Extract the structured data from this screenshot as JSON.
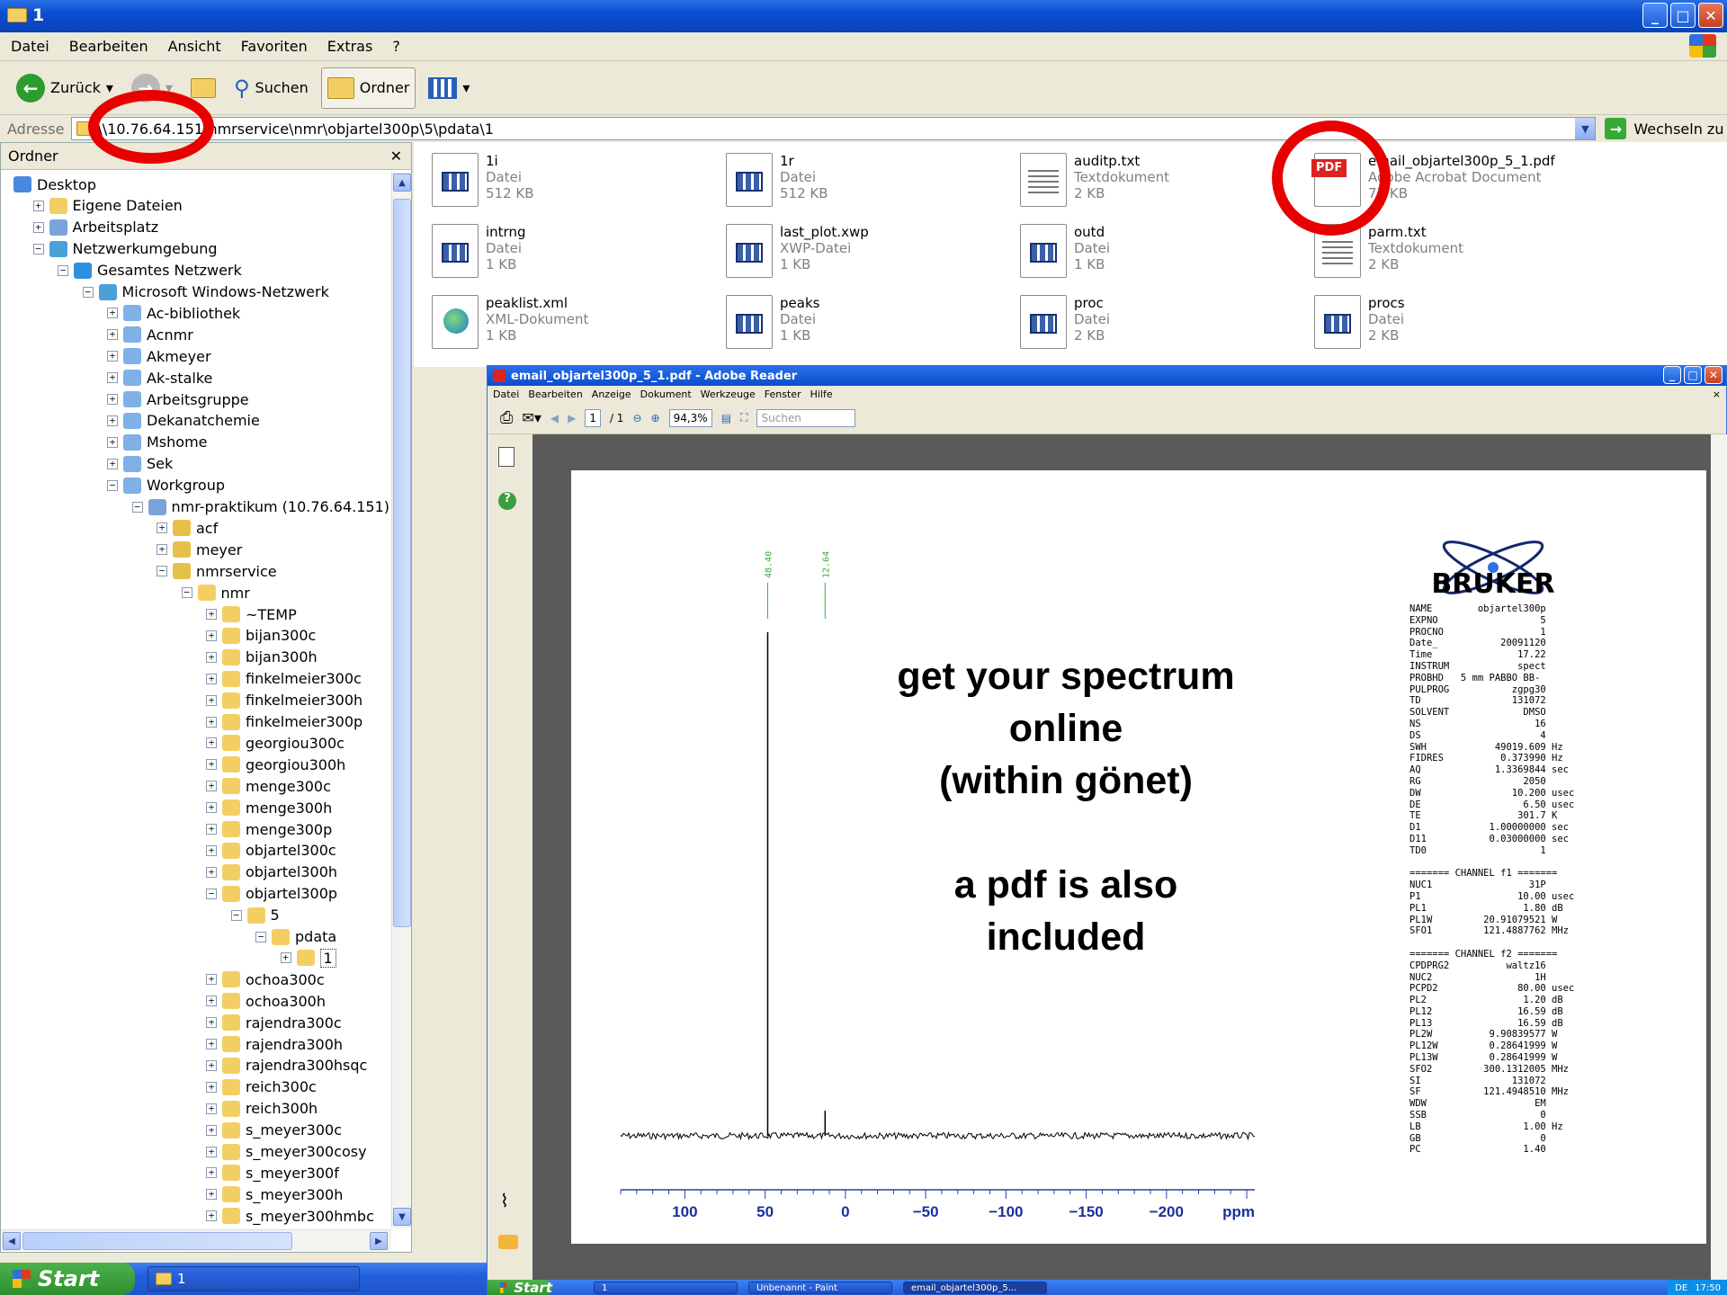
{
  "window": {
    "title": "1",
    "buttons": {
      "minimize": "_",
      "maximize": "□",
      "close": "✕"
    }
  },
  "menu": [
    "Datei",
    "Bearbeiten",
    "Ansicht",
    "Favoriten",
    "Extras",
    "?"
  ],
  "toolbar": {
    "back": "Zurück",
    "search": "Suchen",
    "folders": "Ordner"
  },
  "address": {
    "label": "Adresse",
    "value": "\\\\10.76.64.151\\nmrservice\\nmr\\objartel300p\\5\\pdata\\1",
    "go": "Wechseln zu"
  },
  "folder_pane": {
    "title": "Ordner",
    "close": "✕"
  },
  "tree": [
    {
      "label": "Desktop",
      "level": 0,
      "exp": "",
      "icon": "desktop-icon"
    },
    {
      "label": "Eigene Dateien",
      "level": 1,
      "exp": "+",
      "icon": "folder-icon"
    },
    {
      "label": "Arbeitsplatz",
      "level": 1,
      "exp": "+",
      "icon": "computer-icon"
    },
    {
      "label": "Netzwerkumgebung",
      "level": 1,
      "exp": "−",
      "icon": "network-icon"
    },
    {
      "label": "Gesamtes Netzwerk",
      "level": 2,
      "exp": "−",
      "icon": "globe-icon"
    },
    {
      "label": "Microsoft Windows-Netzwerk",
      "level": 3,
      "exp": "−",
      "icon": "network-icon"
    },
    {
      "label": "Ac-bibliothek",
      "level": 4,
      "exp": "+",
      "icon": "workgroup-icon"
    },
    {
      "label": "Acnmr",
      "level": 4,
      "exp": "+",
      "icon": "workgroup-icon"
    },
    {
      "label": "Akmeyer",
      "level": 4,
      "exp": "+",
      "icon": "workgroup-icon"
    },
    {
      "label": "Ak-stalke",
      "level": 4,
      "exp": "+",
      "icon": "workgroup-icon"
    },
    {
      "label": "Arbeitsgruppe",
      "level": 4,
      "exp": "+",
      "icon": "workgroup-icon"
    },
    {
      "label": "Dekanatchemie",
      "level": 4,
      "exp": "+",
      "icon": "workgroup-icon"
    },
    {
      "label": "Mshome",
      "level": 4,
      "exp": "+",
      "icon": "workgroup-icon"
    },
    {
      "label": "Sek",
      "level": 4,
      "exp": "+",
      "icon": "workgroup-icon"
    },
    {
      "label": "Workgroup",
      "level": 4,
      "exp": "−",
      "icon": "workgroup-icon"
    },
    {
      "label": "nmr-praktikum (10.76.64.151)",
      "level": 5,
      "exp": "−",
      "icon": "computer-icon"
    },
    {
      "label": "acf",
      "level": 6,
      "exp": "+",
      "icon": "share-icon"
    },
    {
      "label": "meyer",
      "level": 6,
      "exp": "+",
      "icon": "share-icon"
    },
    {
      "label": "nmrservice",
      "level": 6,
      "exp": "−",
      "icon": "share-icon"
    },
    {
      "label": "nmr",
      "level": 7,
      "exp": "−",
      "icon": "folder-icon"
    },
    {
      "label": "~TEMP",
      "level": 8,
      "exp": "+",
      "icon": "folder-icon"
    },
    {
      "label": "bijan300c",
      "level": 8,
      "exp": "+",
      "icon": "folder-icon"
    },
    {
      "label": "bijan300h",
      "level": 8,
      "exp": "+",
      "icon": "folder-icon"
    },
    {
      "label": "finkelmeier300c",
      "level": 8,
      "exp": "+",
      "icon": "folder-icon"
    },
    {
      "label": "finkelmeier300h",
      "level": 8,
      "exp": "+",
      "icon": "folder-icon"
    },
    {
      "label": "finkelmeier300p",
      "level": 8,
      "exp": "+",
      "icon": "folder-icon"
    },
    {
      "label": "georgiou300c",
      "level": 8,
      "exp": "+",
      "icon": "folder-icon"
    },
    {
      "label": "georgiou300h",
      "level": 8,
      "exp": "+",
      "icon": "folder-icon"
    },
    {
      "label": "menge300c",
      "level": 8,
      "exp": "+",
      "icon": "folder-icon"
    },
    {
      "label": "menge300h",
      "level": 8,
      "exp": "+",
      "icon": "folder-icon"
    },
    {
      "label": "menge300p",
      "level": 8,
      "exp": "+",
      "icon": "folder-icon"
    },
    {
      "label": "objartel300c",
      "level": 8,
      "exp": "+",
      "icon": "folder-icon"
    },
    {
      "label": "objartel300h",
      "level": 8,
      "exp": "+",
      "icon": "folder-icon"
    },
    {
      "label": "objartel300p",
      "level": 8,
      "exp": "−",
      "icon": "folder-icon"
    },
    {
      "label": "5",
      "level": 9,
      "exp": "−",
      "icon": "folder-icon"
    },
    {
      "label": "pdata",
      "level": 10,
      "exp": "−",
      "icon": "folder-icon"
    },
    {
      "label": "1",
      "level": 11,
      "exp": "+",
      "icon": "folder-icon",
      "selected": true
    },
    {
      "label": "ochoa300c",
      "level": 8,
      "exp": "+",
      "icon": "folder-icon"
    },
    {
      "label": "ochoa300h",
      "level": 8,
      "exp": "+",
      "icon": "folder-icon"
    },
    {
      "label": "rajendra300c",
      "level": 8,
      "exp": "+",
      "icon": "folder-icon"
    },
    {
      "label": "rajendra300h",
      "level": 8,
      "exp": "+",
      "icon": "folder-icon"
    },
    {
      "label": "rajendra300hsqc",
      "level": 8,
      "exp": "+",
      "icon": "folder-icon"
    },
    {
      "label": "reich300c",
      "level": 8,
      "exp": "+",
      "icon": "folder-icon"
    },
    {
      "label": "reich300h",
      "level": 8,
      "exp": "+",
      "icon": "folder-icon"
    },
    {
      "label": "s_meyer300c",
      "level": 8,
      "exp": "+",
      "icon": "folder-icon"
    },
    {
      "label": "s_meyer300cosy",
      "level": 8,
      "exp": "+",
      "icon": "folder-icon"
    },
    {
      "label": "s_meyer300f",
      "level": 8,
      "exp": "+",
      "icon": "folder-icon"
    },
    {
      "label": "s_meyer300h",
      "level": 8,
      "exp": "+",
      "icon": "folder-icon"
    },
    {
      "label": "s_meyer300hmbc",
      "level": 8,
      "exp": "+",
      "icon": "folder-icon"
    }
  ],
  "files": [
    {
      "name": "1i",
      "type": "Datei",
      "size": "512 KB",
      "kind": "data"
    },
    {
      "name": "1r",
      "type": "Datei",
      "size": "512 KB",
      "kind": "data"
    },
    {
      "name": "auditp.txt",
      "type": "Textdokument",
      "size": "2 KB",
      "kind": "text"
    },
    {
      "name": "email_objartel300p_5_1.pdf",
      "type": "Adobe Acrobat Document",
      "size": "77 KB",
      "kind": "pdf"
    },
    {
      "name": "intrng",
      "type": "Datei",
      "size": "1 KB",
      "kind": "data"
    },
    {
      "name": "last_plot.xwp",
      "type": "XWP-Datei",
      "size": "1 KB",
      "kind": "data"
    },
    {
      "name": "outd",
      "type": "Datei",
      "size": "1 KB",
      "kind": "data"
    },
    {
      "name": "parm.txt",
      "type": "Textdokument",
      "size": "2 KB",
      "kind": "text"
    },
    {
      "name": "peaklist.xml",
      "type": "XML-Dokument",
      "size": "1 KB",
      "kind": "xml"
    },
    {
      "name": "peaks",
      "type": "Datei",
      "size": "1 KB",
      "kind": "data"
    },
    {
      "name": "proc",
      "type": "Datei",
      "size": "2 KB",
      "kind": "data"
    },
    {
      "name": "procs",
      "type": "Datei",
      "size": "2 KB",
      "kind": "data"
    }
  ],
  "reader": {
    "title": "email_objartel300p_5_1.pdf - Adobe Reader",
    "menu": [
      "Datei",
      "Bearbeiten",
      "Anzeige",
      "Dokument",
      "Werkzeuge",
      "Fenster",
      "Hilfe"
    ],
    "page_current": "1",
    "page_total": "/ 1",
    "zoom": "94,3%",
    "search_placeholder": "Suchen"
  },
  "overlay_text": {
    "line1": "get your spectrum",
    "line2": "online",
    "line3": "(within gönet)",
    "line4": "a pdf is also",
    "line5": "included"
  },
  "bruker": {
    "logo": "BRUKER"
  },
  "params_text": "NAME        objartel300p\nEXPNO                  5\nPROCNO                 1\nDate_           20091120\nTime               17.22\nINSTRUM            spect\nPROBHD   5 mm PABBO BB-\nPULPROG           zgpg30\nTD                131072\nSOLVENT             DMSO\nNS                    16\nDS                     4\nSWH            49019.609 Hz\nFIDRES          0.373990 Hz\nAQ             1.3369844 sec\nRG                  2050\nDW                10.200 usec\nDE                  6.50 usec\nTE                 301.7 K\nD1            1.00000000 sec\nD11           0.03000000 sec\nTD0                    1\n\n======= CHANNEL f1 =======\nNUC1                 31P\nP1                 10.00 usec\nPL1                 1.80 dB\nPL1W         20.91079521 W\nSFO1         121.4887762 MHz\n\n======= CHANNEL f2 =======\nCPDPRG2          waltz16\nNUC2                  1H\nPCPD2              80.00 usec\nPL2                 1.20 dB\nPL12               16.59 dB\nPL13               16.59 dB\nPL2W          9.90839577 W\nPL12W         0.28641999 W\nPL13W         0.28641999 W\nSFO2         300.1312005 MHz\nSI                131072\nSF           121.4948510 MHz\nWDW                   EM\nSSB                    0\nLB                  1.00 Hz\nGB                     0\nPC                  1.40",
  "chart_data": {
    "type": "line",
    "title": "",
    "xlabel": "ppm",
    "xlim": [
      140,
      -255
    ],
    "x_reversed": true,
    "x_ticks": [
      100,
      50,
      0,
      -50,
      -100,
      -150,
      -200
    ],
    "x_tick_labels": [
      "100",
      "50",
      "0",
      "−50",
      "−100",
      "−150",
      "−200"
    ],
    "peaks": [
      {
        "x": 48.4,
        "label": "48.40",
        "height": 1.0
      },
      {
        "x": 12.64,
        "label": "12.64",
        "height": 0.05
      }
    ],
    "series": [
      {
        "values": [
          [
            140,
            0
          ],
          [
            48.4,
            0
          ],
          [
            48.4,
            1.0
          ],
          [
            48.4,
            0
          ],
          [
            12.64,
            0
          ],
          [
            12.64,
            0.05
          ],
          [
            12.64,
            0
          ],
          [
            -255,
            0
          ]
        ]
      }
    ]
  },
  "taskbar": {
    "start": "Start",
    "items": [
      "1"
    ]
  },
  "reader_taskbar": {
    "start": "Start",
    "items": [
      "1",
      "Unbenannt - Paint",
      "email_objartel300p_5..."
    ],
    "lang": "DE",
    "time": "17:50"
  }
}
